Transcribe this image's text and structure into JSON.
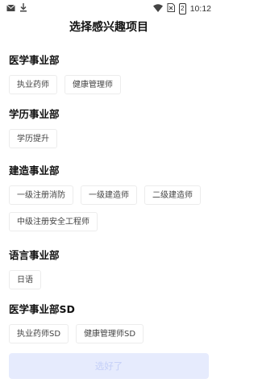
{
  "status_bar": {
    "time": "10:12",
    "battery": "2",
    "icons": [
      "mail-icon",
      "download-icon",
      "wifi-icon",
      "no-sim-icon",
      "battery-icon"
    ]
  },
  "title": "选择感兴趣项目",
  "sections": [
    {
      "title": "医学事业部",
      "tags": [
        "执业药师",
        "健康管理师"
      ]
    },
    {
      "title": "学历事业部",
      "tags": [
        "学历提升"
      ]
    },
    {
      "title": "建造事业部",
      "tags": [
        "一级注册消防",
        "一级建造师",
        "二级建造师",
        "中级注册安全工程师"
      ]
    },
    {
      "title": "语言事业部",
      "tags": [
        "日语"
      ]
    },
    {
      "title": "医学事业部SD",
      "tags": [
        "执业药师SD",
        "健康管理师SD"
      ]
    }
  ],
  "confirm_label": "选好了",
  "colors": {
    "button_bg": "#e6ebfd",
    "button_text": "#c4cff8",
    "tag_border": "#ececec"
  }
}
